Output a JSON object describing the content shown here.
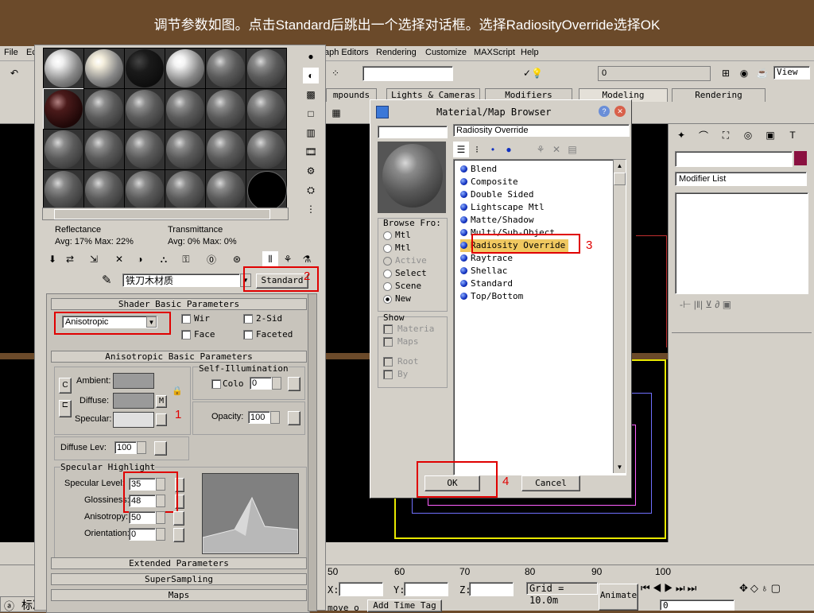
{
  "banner": {
    "text": "调节参数如图。点击Standard后跳出一个选择对话框。选择RadiosityOverride选择OK"
  },
  "menubar": {
    "file": "File",
    "edit": "Ec",
    "graph_editors": "aph Editors",
    "rendering": "Rendering",
    "customize": "Customize",
    "maxscript": "MAXScript",
    "help": "Help"
  },
  "toolbar": {
    "selection_set_value": "0",
    "view_label": "View"
  },
  "tabs": {
    "compounds": "mpounds",
    "lights_cameras": "Lights & Cameras",
    "modifiers": "Modifiers",
    "modeling": "Modeling",
    "rendering": "Rendering"
  },
  "cmd_panel": {
    "modifier_list": "Modifier List"
  },
  "mat_editor": {
    "reflectance_label": "Reflectance",
    "reflectance_value": "Avg:   17% Max:  22%",
    "transmittance_label": "Transmittance",
    "transmittance_value": "Avg:    0% Max:    0%",
    "material_name": "铁刀木材质",
    "material_type": "Standard",
    "shader_rollout": "Shader Basic Parameters",
    "shader_value": "Anisotropic",
    "wire_label": "Wir",
    "two_sided_label": "2-Sid",
    "face_map_label": "Face",
    "faceted_label": "Faceted",
    "aniso_rollout": "Anisotropic Basic Parameters",
    "ambient_label": "Ambient:",
    "diffuse_label": "Diffuse:",
    "specular_label": "Specular:",
    "lock_label": "C",
    "map_m_label": "M",
    "self_illum_label": "Self-Illumination",
    "color_label": "Colo",
    "self_illum_value": "0",
    "opacity_label": "Opacity:",
    "opacity_value": "100",
    "diffuse_level_label": "Diffuse Lev:",
    "diffuse_level_value": "100",
    "spec_highlight_label": "Specular Highlight",
    "spec_level_label": "Specular Level:",
    "spec_level_value": "35",
    "glossiness_label": "Glossiness:",
    "glossiness_value": "48",
    "anisotropy_label": "Anisotropy:",
    "anisotropy_value": "50",
    "orientation_label": "Orientation:",
    "orientation_value": "0",
    "extended_rollout": "Extended Parameters",
    "supersampling_rollout": "SuperSampling",
    "maps_rollout": "Maps",
    "annot_1": "1",
    "annot_2": "2"
  },
  "browser": {
    "title": "Material/Map Browser",
    "selected_name": "Radiosity Override",
    "browse_from_label": "Browse Fro:",
    "browse_options": [
      "Mtl",
      "Mtl",
      "Active",
      "Select",
      "Scene",
      "New"
    ],
    "show_label": "Show",
    "show_options": [
      "Materia",
      "Maps"
    ],
    "root_label": "Root",
    "by_label": "By",
    "items": [
      "Blend",
      "Composite",
      "Double Sided",
      "Lightscape Mtl",
      "Matte/Shadow",
      "Multi/Sub-Object",
      "Radiosity Override",
      "Raytrace",
      "Shellac",
      "Standard",
      "Top/Bottom"
    ],
    "ok_label": "OK",
    "cancel_label": "Cancel",
    "annot_3": "3",
    "annot_4": "4"
  },
  "timeline": {
    "ticks": [
      "50",
      "60",
      "70",
      "80",
      "90",
      "100"
    ]
  },
  "status": {
    "x_label": "X:",
    "y_label": "Y:",
    "z_label": "Z:",
    "grid": "Grid = 10.0m",
    "animate": "Animate",
    "move_label": "move o",
    "add_time_tag": "Add Time Tag",
    "frame_value": "0",
    "taskbar_label": "标准"
  }
}
